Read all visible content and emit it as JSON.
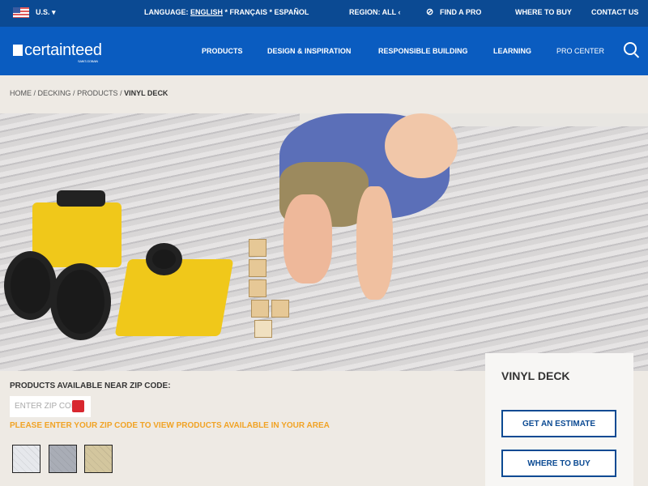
{
  "topbar": {
    "country": "U.S. ▾",
    "language_label": "LANGUAGE:",
    "language_current": "ENGLISH",
    "language_others": " * FRANÇAIS * ESPAÑOL",
    "region": "REGION: ALL ‹",
    "find_pro": "FIND A PRO",
    "where_to_buy": "WHERE TO BUY",
    "contact": "CONTACT US"
  },
  "nav": {
    "logo": "certainteed",
    "logo_sub": "SAINT-GOBAIN",
    "items": [
      "PRODUCTS",
      "DESIGN & INSPIRATION",
      "RESPONSIBLE BUILDING",
      "LEARNING",
      "PRO CENTER"
    ]
  },
  "breadcrumb": [
    "HOME /",
    "DECKING /",
    "PRODUCTS /",
    "VINYL DECK"
  ],
  "zip": {
    "label": "PRODUCTS AVAILABLE NEAR ZIP CODE:",
    "placeholder": "ENTER ZIP CODE",
    "warning": "PLEASE ENTER YOUR ZIP CODE TO VIEW PRODUCTS AVAILABLE IN YOUR AREA"
  },
  "swatches": [
    "#e6e8ec",
    "#a9adb6",
    "#d3c69e"
  ],
  "sidebar": {
    "title": "VINYL DECK",
    "estimate": "GET AN ESTIMATE",
    "where": "WHERE TO BUY"
  }
}
